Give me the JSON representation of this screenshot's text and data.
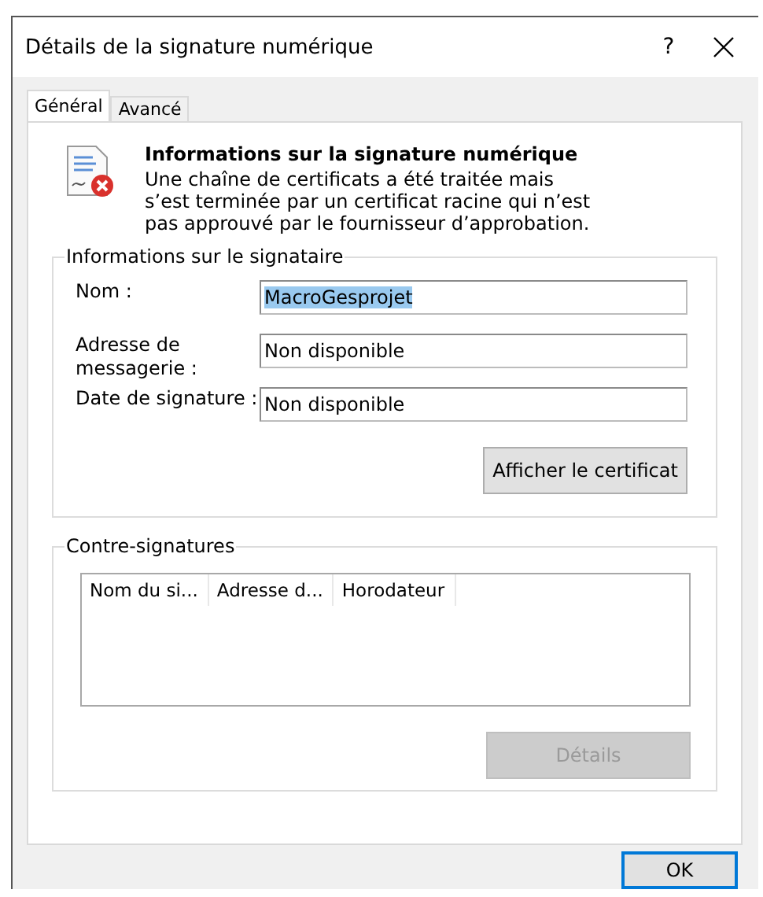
{
  "window": {
    "title": "Détails de la signature numérique",
    "help": "?"
  },
  "tabs": [
    {
      "label": "Général",
      "selected": true
    },
    {
      "label": "Avancé",
      "selected": false
    }
  ],
  "header": {
    "title": "Informations sur la signature numérique",
    "message": "Une chaîne de certificats a été traitée mais s’est terminée par un certificat racine qui n’est pas approuvé par le fournisseur d’approbation."
  },
  "signer": {
    "title": "Informations sur le signataire",
    "fields": [
      {
        "label": "Nom :",
        "value": "MacroGesprojet",
        "selected": true
      },
      {
        "label": "Adresse de messagerie :",
        "value": "Non disponible",
        "selected": false
      },
      {
        "label": "Date de signature :",
        "value": "Non disponible",
        "selected": false
      }
    ],
    "button": {
      "label": "Afficher le certificat",
      "disabled": false
    }
  },
  "countersignatures": {
    "title": "Contre-signatures",
    "columns": [
      "Nom du si...",
      "Adresse d...",
      "Horodateur"
    ],
    "button": {
      "label": "Détails",
      "disabled": true
    }
  },
  "ok_button": {
    "label": "OK",
    "default": true
  }
}
